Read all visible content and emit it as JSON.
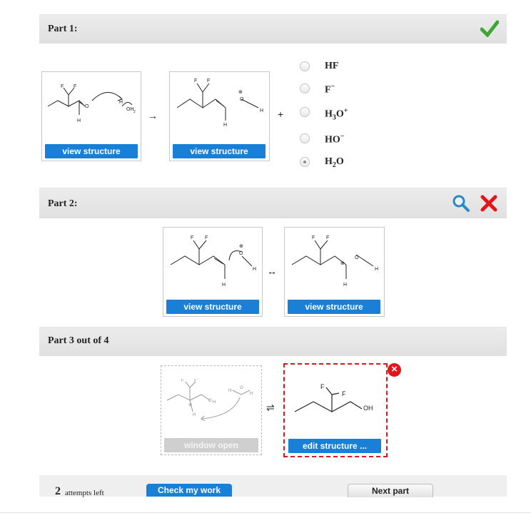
{
  "part1": {
    "title": "Part 1:",
    "view_btn_1": "view structure",
    "view_btn_2": "view structure",
    "arrow": "→",
    "plus": "+",
    "options": [
      {
        "base": "HF",
        "sub": "",
        "sup": "",
        "selected": false
      },
      {
        "base": "F",
        "sub": "",
        "sup": "−",
        "selected": false
      },
      {
        "base": "H",
        "sub": "3",
        "tail": "O",
        "sup": "+",
        "selected": false
      },
      {
        "base": "HO",
        "sub": "",
        "sup": "−",
        "selected": false
      },
      {
        "base": "H",
        "sub": "2",
        "tail": "O",
        "sup": "",
        "selected": true
      }
    ]
  },
  "part2": {
    "title": "Part 2:",
    "view_btn_1": "view structure",
    "view_btn_2": "view structure",
    "resonance": "↔"
  },
  "part3": {
    "title": "Part 3 out of 4",
    "window_btn": "window open",
    "edit_btn": "edit structure ...",
    "equilibrium": "⇌",
    "close": "×"
  },
  "footer": {
    "attempts_num": "2",
    "attempts_label": "attempts left",
    "check": "Check my work",
    "next": "Next part"
  },
  "colors": {
    "check_green": "#3da635",
    "wrong_red": "#e0161a",
    "button_blue": "#1a7fd6"
  }
}
